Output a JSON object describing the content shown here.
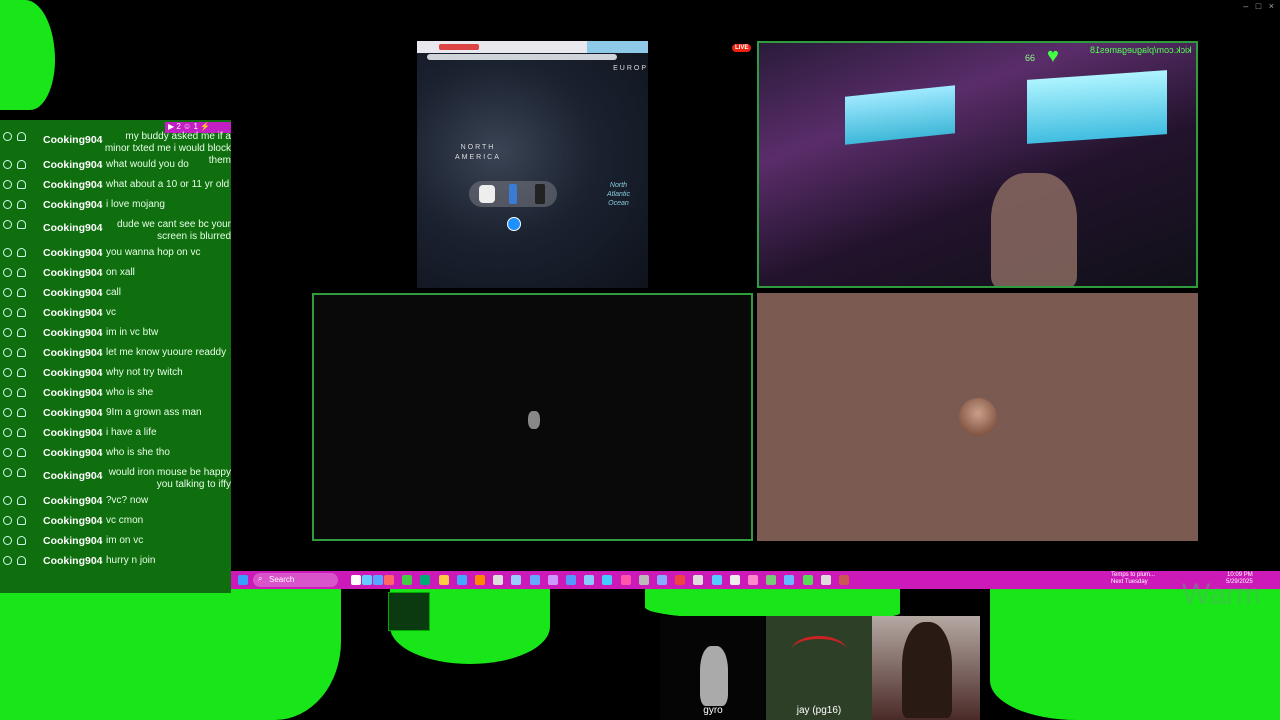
{
  "window_controls": [
    "–",
    "□",
    "×"
  ],
  "live_badge": "LIVE",
  "chat": {
    "badges_text": "▶ 2  ☺ 1  ⚡",
    "messages": [
      {
        "user": "Cooking904",
        "text": "my buddy asked me if a minor txted me i would block them",
        "two": true
      },
      {
        "user": "Cooking904",
        "text": "what would you do"
      },
      {
        "user": "Cooking904",
        "text": "what about a 10 or 11 yr old"
      },
      {
        "user": "Cooking904",
        "text": "i love mojang"
      },
      {
        "user": "Cooking904",
        "text": "dude we cant see bc your screen is blurred",
        "two": true
      },
      {
        "user": "Cooking904",
        "text": "you wanna hop on vc"
      },
      {
        "user": "Cooking904",
        "text": "on xall"
      },
      {
        "user": "Cooking904",
        "text": "call"
      },
      {
        "user": "Cooking904",
        "text": "vc"
      },
      {
        "user": "Cooking904",
        "text": "im in vc btw"
      },
      {
        "user": "Cooking904",
        "text": "let me know yuoure readdy"
      },
      {
        "user": "Cooking904",
        "text": "why not try twitch"
      },
      {
        "user": "Cooking904",
        "text": "who is she"
      },
      {
        "user": "Cooking904",
        "text": "9Im a grown ass man"
      },
      {
        "user": "Cooking904",
        "text": "i have a life"
      },
      {
        "user": "Cooking904",
        "text": "who is she tho"
      },
      {
        "user": "Cooking904",
        "text": "would iron mouse be happy you talking to iffy",
        "two": true
      },
      {
        "user": "Cooking904",
        "text": "?vc? now"
      },
      {
        "user": "Cooking904",
        "text": "vc cmon"
      },
      {
        "user": "Cooking904",
        "text": "im on vc"
      },
      {
        "user": "Cooking904",
        "text": "hurry n join"
      }
    ]
  },
  "map": {
    "europe_label": "EUROP",
    "north_america_label": "NORTH\nAMERICA",
    "ocean_label": "North\nAtlantic\nOcean"
  },
  "stream_overlay": {
    "kick_text": "kick.com/plaguegames18",
    "heart_count": "66"
  },
  "taskbar": {
    "search_placeholder": "Search",
    "weather_text": "Temps to plum...",
    "weather_sub": "Next Tuesday",
    "clock_time": "10:09 PM",
    "clock_date": "5/29/2025",
    "watermark": "Warm"
  },
  "participants": [
    {
      "name": "gyro"
    },
    {
      "name": "jay (pg16)"
    },
    {
      "name": ""
    }
  ],
  "colors": {
    "chroma_green": "#19e619",
    "chat_bg": "#0f6f0f",
    "taskbar": "#cc1ab8",
    "tile_border": "#2f9d3d",
    "brown_tile": "#7a5a51"
  }
}
